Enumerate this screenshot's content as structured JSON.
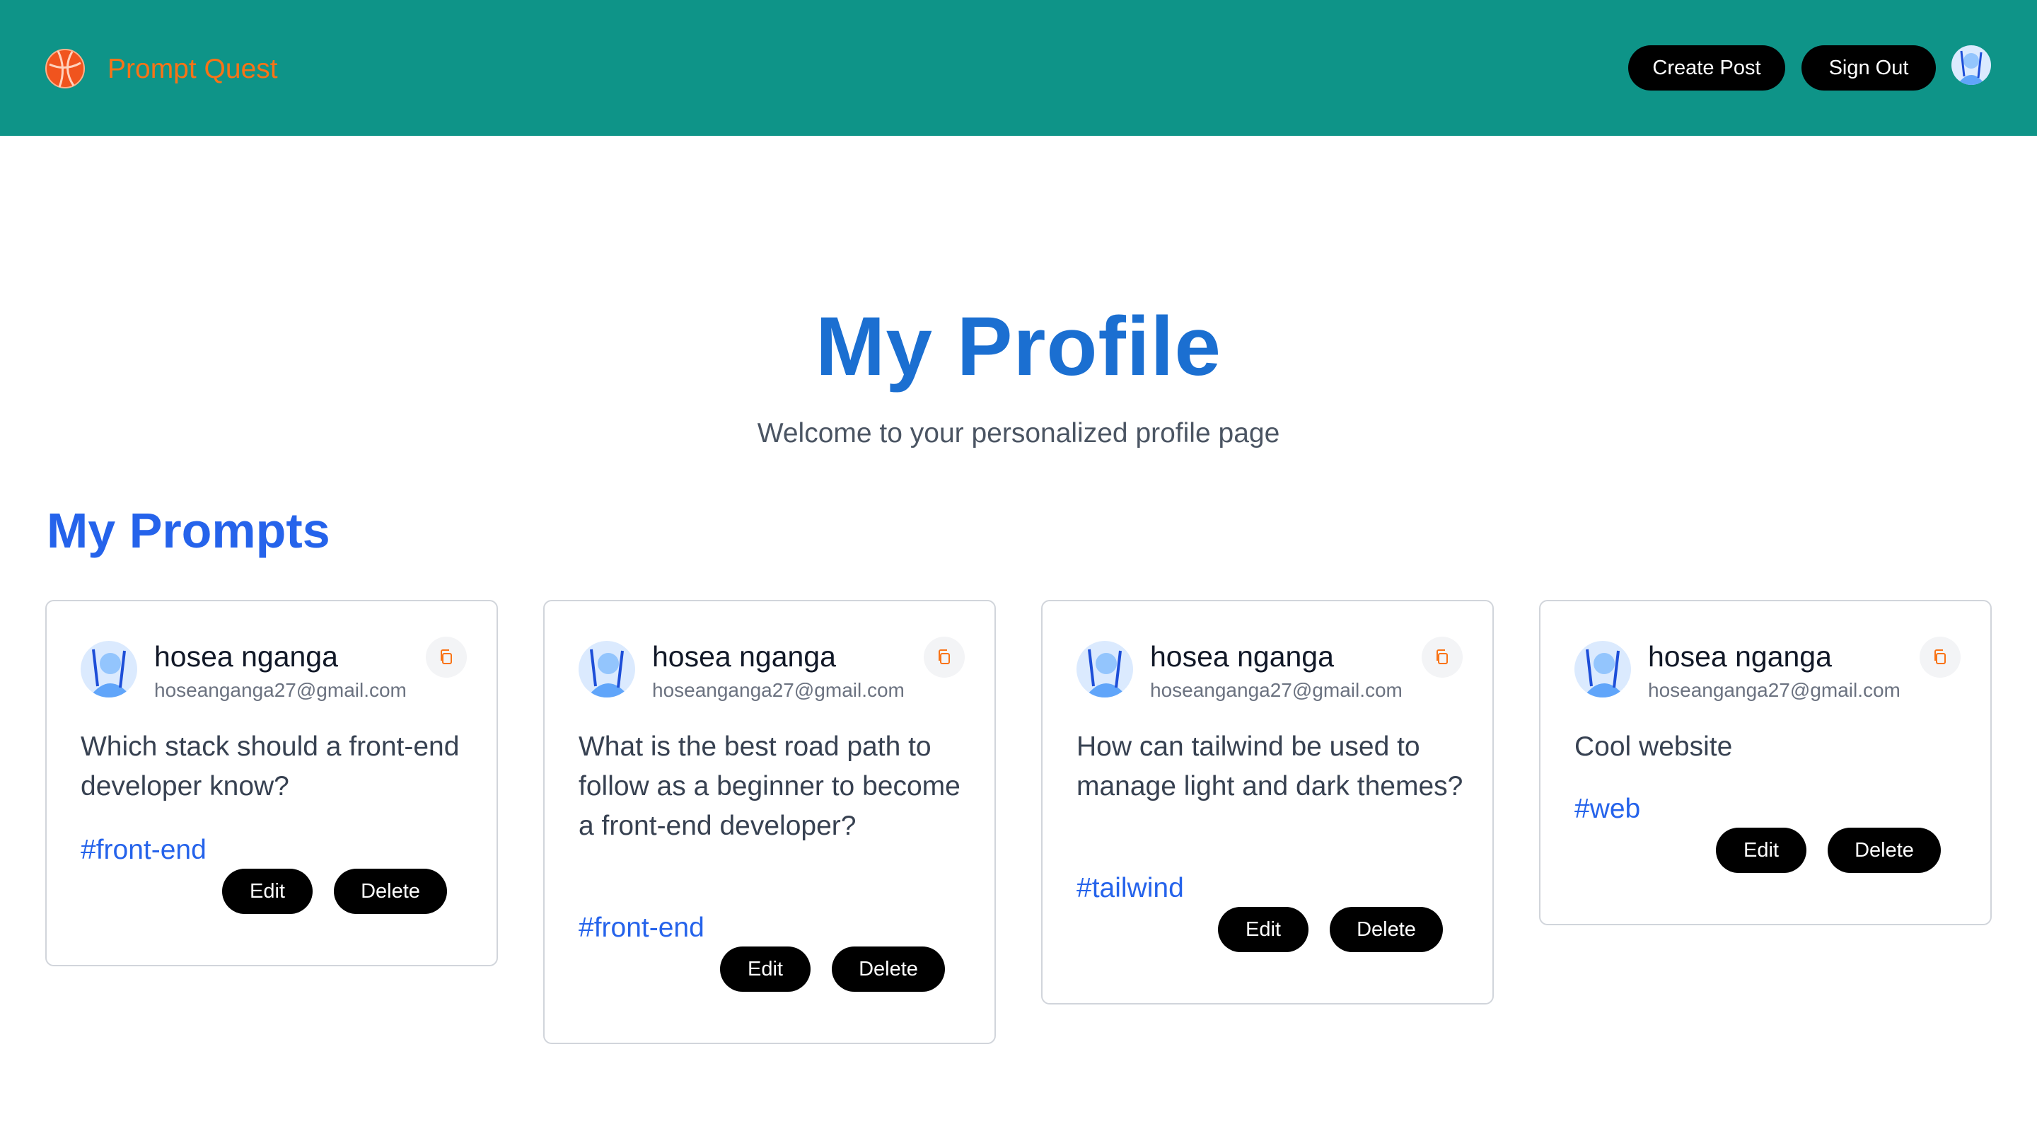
{
  "header": {
    "brand": "Prompt Quest",
    "create_label": "Create Post",
    "signout_label": "Sign Out"
  },
  "profile": {
    "title": "My Profile",
    "subtitle": "Welcome to your personalized profile page"
  },
  "section": {
    "title": "My Prompts"
  },
  "prompts": [
    {
      "name": "hosea nganga",
      "email": "hoseanganga27@gmail.com",
      "text": "Which stack should a front-end developer know?",
      "tag": "#front-end",
      "edit_label": "Edit",
      "delete_label": "Delete"
    },
    {
      "name": "hosea nganga",
      "email": "hoseanganga27@gmail.com",
      "text": "What is the best road path to follow as a beginner to become a front-end developer?",
      "tag": "#front-end",
      "edit_label": "Edit",
      "delete_label": "Delete"
    },
    {
      "name": "hosea nganga",
      "email": "hoseanganga27@gmail.com",
      "text": "How can tailwind be used to manage light and dark themes?",
      "tag": "#tailwind",
      "edit_label": "Edit",
      "delete_label": "Delete"
    },
    {
      "name": "hosea nganga",
      "email": "hoseanganga27@gmail.com",
      "text": "Cool website",
      "tag": "#web",
      "edit_label": "Edit",
      "delete_label": "Delete"
    }
  ],
  "colors": {
    "navbar": "#0e9488",
    "brand": "#f97316",
    "title": "#1b6fd1",
    "accent": "#2563eb",
    "button": "#000000"
  },
  "icons": [
    "logo-icon",
    "avatar",
    "copy-icon"
  ]
}
